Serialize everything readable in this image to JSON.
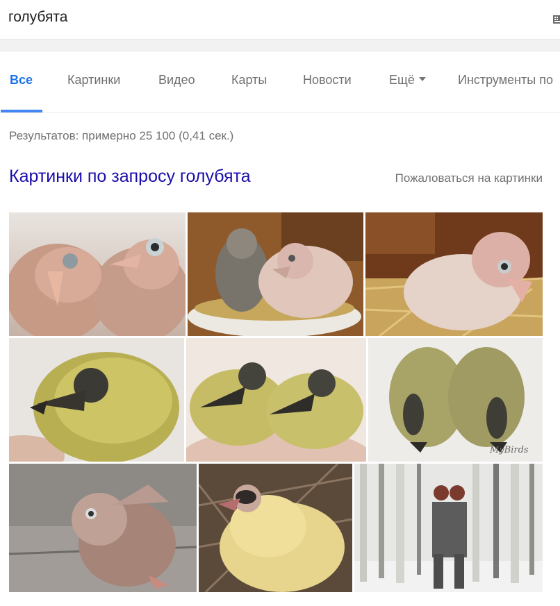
{
  "search": {
    "query": "голубята"
  },
  "tabs": [
    {
      "label": "Все",
      "active": true
    },
    {
      "label": "Картинки"
    },
    {
      "label": "Видео"
    },
    {
      "label": "Карты"
    },
    {
      "label": "Новости"
    },
    {
      "label": "Ещё"
    },
    {
      "label": "Инструменты по"
    }
  ],
  "results_stats": "Результатов: примерно 25 100 (0,41 сек.)",
  "images_section": {
    "title": "Картинки по запросу голубята",
    "report_link": "Пожаловаться на картинки",
    "thumbnails": [
      {
        "subject": "two pink squabs close-up"
      },
      {
        "subject": "squabs in white bowl"
      },
      {
        "subject": "pink squab in straw nest"
      },
      {
        "subject": "yellow fuzzy squab in hand"
      },
      {
        "subject": "two yellow squabs in palm"
      },
      {
        "subject": "two downy squabs",
        "watermark": "MyBirds"
      },
      {
        "subject": "young pigeon on stone"
      },
      {
        "subject": "yellow squab in twig nest"
      },
      {
        "subject": "couple in birch forest"
      }
    ]
  },
  "colors": {
    "link": "#1a0dab",
    "accent": "#4285f4",
    "active_tab": "#1a73e8",
    "muted_text": "#707070"
  }
}
